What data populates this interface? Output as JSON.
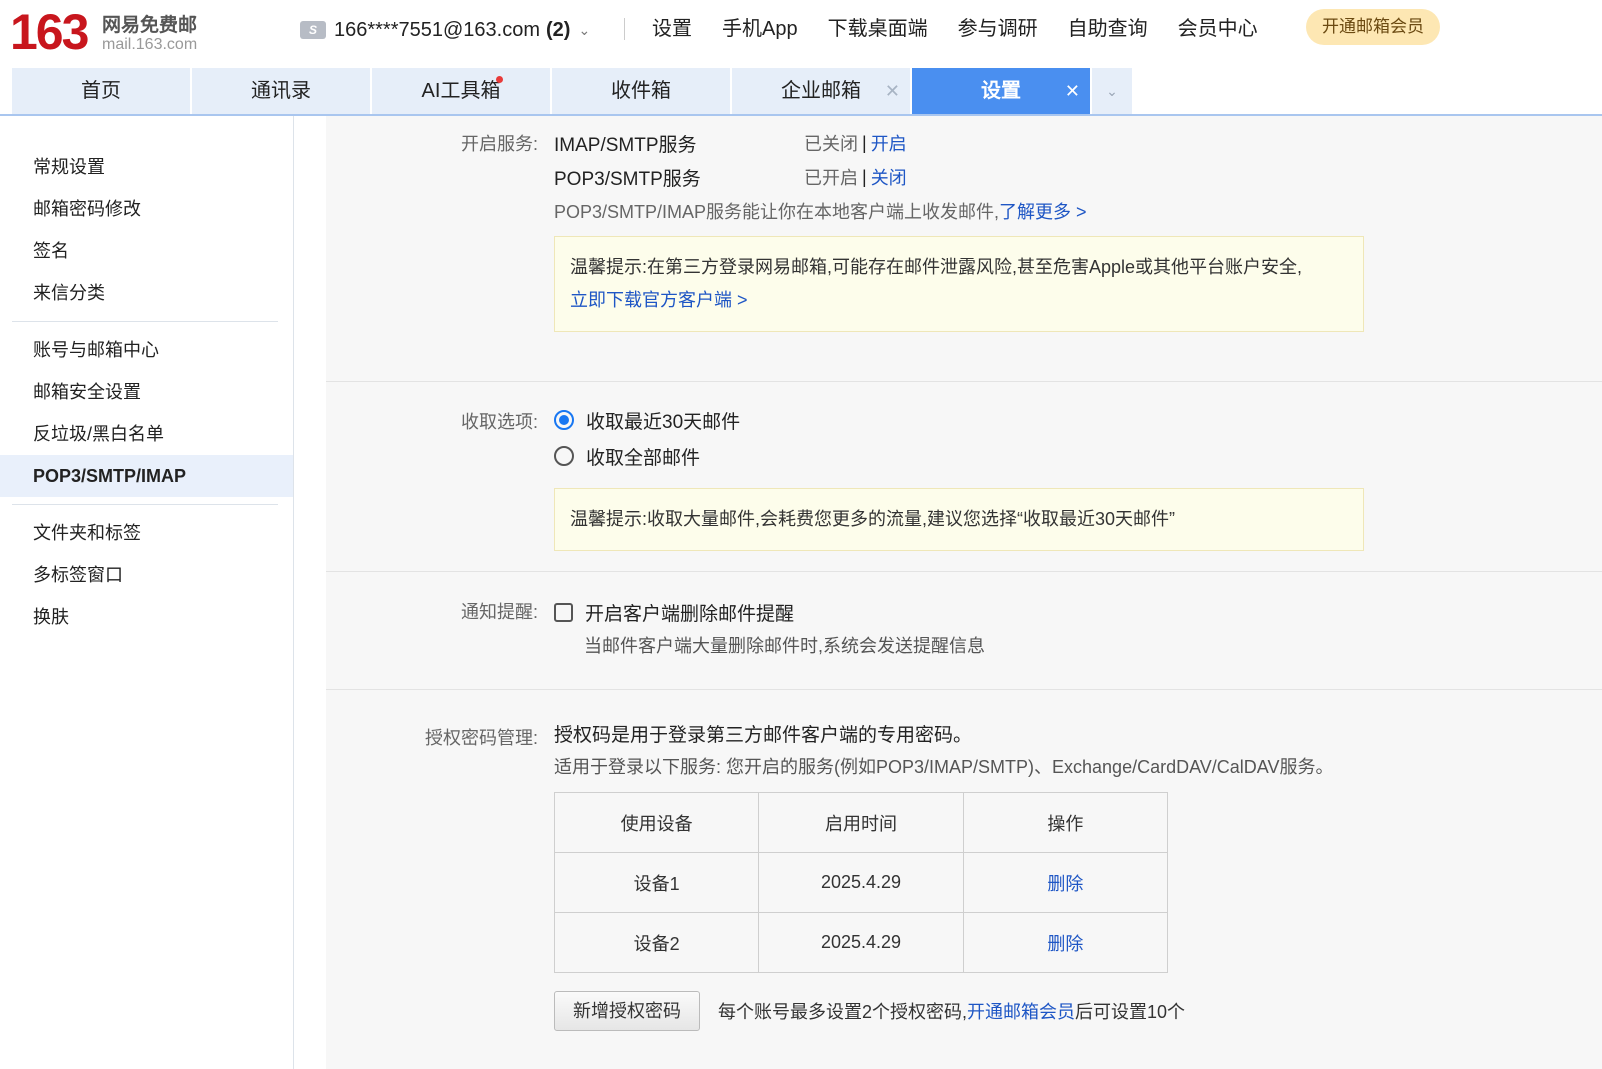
{
  "header": {
    "logo_number": "163",
    "logo_line1": "网易免费邮",
    "logo_line2": "mail.163.com",
    "account_email": "166****7551@163.com",
    "account_count": "(2)",
    "nav": [
      "设置",
      "手机App",
      "下载桌面端",
      "参与调研",
      "自助查询",
      "会员中心"
    ],
    "vip_button": "开通邮箱会员"
  },
  "tabs": [
    {
      "label": "首页"
    },
    {
      "label": "通讯录"
    },
    {
      "label": "AI工具箱"
    },
    {
      "label": "收件箱"
    },
    {
      "label": "企业邮箱"
    },
    {
      "label": "设置"
    }
  ],
  "sidebar": {
    "group1": [
      "常规设置",
      "邮箱密码修改",
      "签名",
      "来信分类"
    ],
    "group2": [
      "账号与邮箱中心",
      "邮箱安全设置",
      "反垃圾/黑白名单",
      "POP3/SMTP/IMAP"
    ],
    "group3": [
      "文件夹和标签",
      "多标签窗口",
      "换肤"
    ]
  },
  "service": {
    "label": "开启服务:",
    "imap": {
      "name": "IMAP/SMTP服务",
      "status": "已关闭",
      "action": "开启"
    },
    "pop3": {
      "name": "POP3/SMTP服务",
      "status": "已开启",
      "action": "关闭"
    },
    "desc": "POP3/SMTP/IMAP服务能让你在本地客户端上收发邮件,",
    "learn_more": "了解更多 >",
    "tip_text": "温馨提示:在第三方登录网易邮箱,可能存在邮件泄露风险,甚至危害Apple或其他平台账户安全,",
    "tip_link": "立即下载官方客户端 >"
  },
  "fetch": {
    "label": "收取选项:",
    "option1": "收取最近30天邮件",
    "option2": "收取全部邮件",
    "tip": "温馨提示:收取大量邮件,会耗费您更多的流量,建议您选择“收取最近30天邮件”"
  },
  "notify": {
    "label": "通知提醒:",
    "checkbox": "开启客户端删除邮件提醒",
    "desc": "当邮件客户端大量删除邮件时,系统会发送提醒信息"
  },
  "auth": {
    "label": "授权密码管理:",
    "line1": "授权码是用于登录第三方邮件客户端的专用密码。",
    "line2": "适用于登录以下服务: 您开启的服务(例如POP3/IMAP/SMTP)、Exchange/CardDAV/CalDAV服务。",
    "headers": [
      "使用设备",
      "启用时间",
      "操作"
    ],
    "rows": [
      {
        "device": "设备1",
        "date": "2025.4.29",
        "action": "删除"
      },
      {
        "device": "设备2",
        "date": "2025.4.29",
        "action": "删除"
      }
    ],
    "new_button": "新增授权密码",
    "note_pre": "每个账号最多设置2个授权密码,",
    "note_link": "开通邮箱会员",
    "note_post": "后可设置10个"
  }
}
